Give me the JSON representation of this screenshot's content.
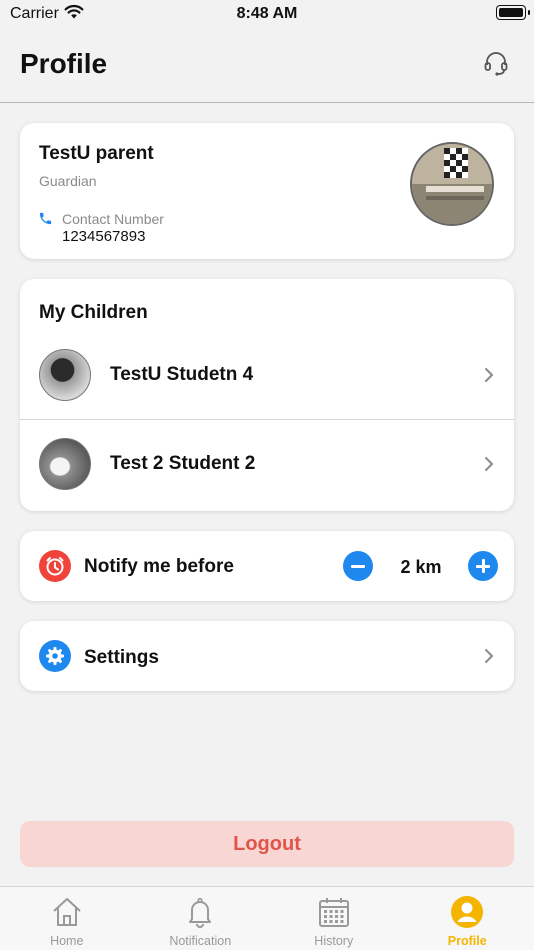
{
  "status_bar": {
    "carrier": "Carrier",
    "time": "8:48 AM"
  },
  "header": {
    "title": "Profile",
    "support_icon": "headset-icon"
  },
  "profile": {
    "name": "TestU parent",
    "role": "Guardian",
    "contact_label": "Contact Number",
    "contact_number": "1234567893"
  },
  "children": {
    "title": "My Children",
    "items": [
      {
        "name": "TestU Studetn 4"
      },
      {
        "name": "Test 2 Student 2"
      }
    ]
  },
  "notify": {
    "label": "Notify me before",
    "value": "2 km"
  },
  "settings": {
    "label": "Settings"
  },
  "logout": {
    "label": "Logout"
  },
  "tabs": [
    {
      "label": "Home",
      "icon": "home-icon"
    },
    {
      "label": "Notification",
      "icon": "bell-icon"
    },
    {
      "label": "History",
      "icon": "calendar-icon"
    },
    {
      "label": "Profile",
      "icon": "user-icon",
      "active": true
    }
  ],
  "colors": {
    "accent_blue": "#1e88ee",
    "alarm_red": "#f0443a",
    "logout_bg": "#f8d6d3",
    "logout_text": "#e0544a",
    "active_tab": "#f4b400"
  }
}
